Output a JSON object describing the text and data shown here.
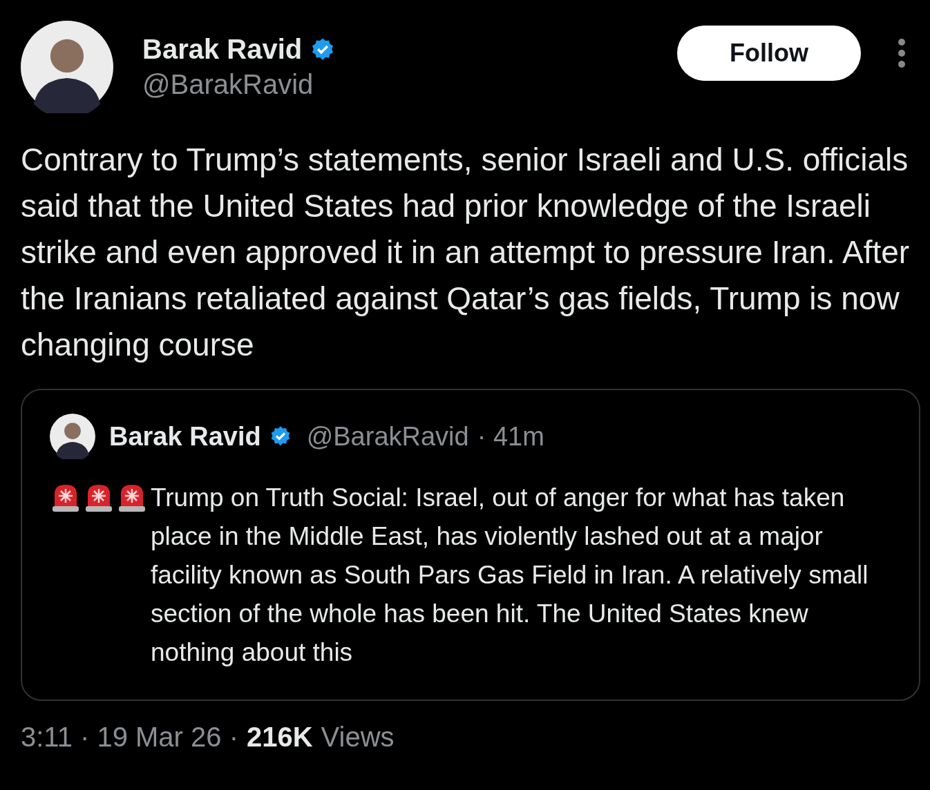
{
  "author": {
    "name": "Barak Ravid",
    "handle": "@BarakRavid",
    "verified": true
  },
  "follow_button": "Follow",
  "text": "Contrary to Trump’s statements, senior Israeli and U.S. officials said that the United States had prior knowledge of the Israeli strike and even approved it in an attempt to pressure Iran. After the Iranians retaliated against Qatar’s gas fields, Trump is now changing course",
  "quoted_post": {
    "author": {
      "name": "Barak Ravid",
      "handle": "@BarakRavid",
      "verified": true
    },
    "time": "· 41m",
    "text": "Trump on Truth Social: Israel, out of anger for what has taken place in the Middle East, has violently lashed out at a major facility known as South Pars Gas Field in Iran. A relatively small section of the whole has been hit. The United States knew nothing about this"
  },
  "footer": {
    "timestamp": "3:11 · 19 Mar 26 ·",
    "views_count": "216K",
    "views_label": "Views"
  }
}
